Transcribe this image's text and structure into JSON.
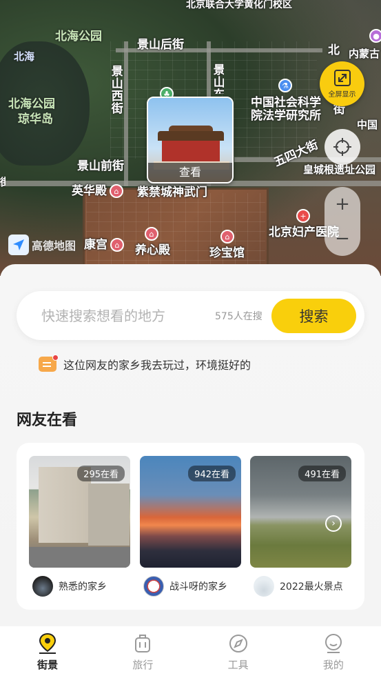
{
  "map": {
    "labels": {
      "beihai_park_top": "北海公园",
      "beihai": "北海",
      "beihai_park_left": "北海公园",
      "qionghua_island": "琼华岛",
      "jingshan_back_st": "景山后街",
      "jingshan_west_st": "景山西街",
      "jingshan_east_st": "景山东",
      "jingshan_front_st": "景山前街",
      "yinghua_hall": "英华殿",
      "shenwu_gate": "紫禁城神武门",
      "shoukang_palace": "康宫",
      "yangxin_hall": "养心殿",
      "treasure_hall": "珍宝馆",
      "cass_institute": "中国社会科学院法学研究所",
      "wusi_st": "五四大街",
      "imperial_wall_park": "皇城根遗址公园",
      "beijing_maternity": "北京妇产医院",
      "huanghuamen_campus": "北京联合大学黄化门校区",
      "bei": "北",
      "inner_mongolia": "内蒙古",
      "zhongguo": "中国",
      "jie": "街",
      "partial_left": "街"
    },
    "preview": {
      "view_label": "查看"
    },
    "fullscreen_label": "全屏显示",
    "zoom_in": "+",
    "zoom_out": "−",
    "logo_text": "高德地图"
  },
  "search": {
    "placeholder": "快速搜索想看的地方",
    "count_text": "575人在搜",
    "button_label": "搜索"
  },
  "tip": {
    "text": "这位网友的家乡我去玩过，环境挺好的"
  },
  "section": {
    "title": "网友在看"
  },
  "cards": [
    {
      "badge": "295在看",
      "user": "熟悉的家乡"
    },
    {
      "badge": "942在看",
      "user": "战斗呀的家乡"
    },
    {
      "badge": "491在看",
      "user": "2022最火景点"
    }
  ],
  "tabs": [
    {
      "label": "街景",
      "icon": "location-pin-icon",
      "active": true
    },
    {
      "label": "旅行",
      "icon": "suitcase-icon",
      "active": false
    },
    {
      "label": "工具",
      "icon": "compass-icon",
      "active": false
    },
    {
      "label": "我的",
      "icon": "profile-icon",
      "active": false
    }
  ],
  "colors": {
    "accent": "#f9cf0c",
    "text": "#222222",
    "muted": "#999999"
  }
}
